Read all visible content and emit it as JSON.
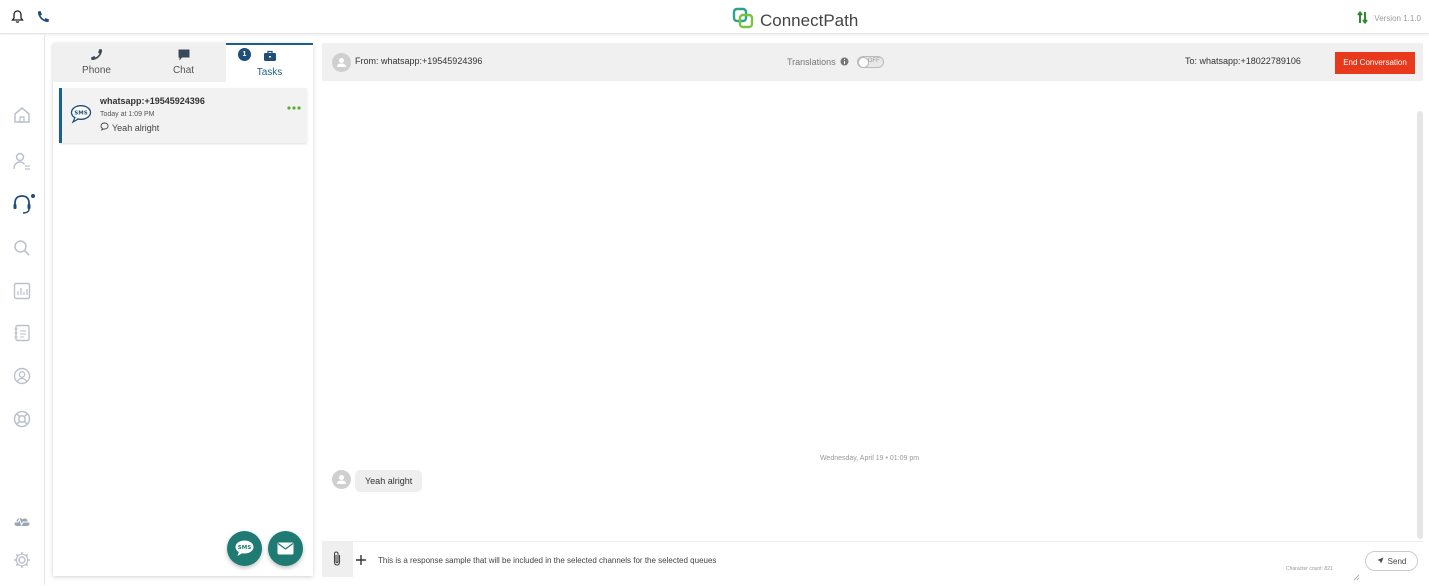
{
  "app": {
    "brand": "ConnectPath",
    "version": "Version 1.1.0"
  },
  "colors": {
    "accent": "#1f5f8b",
    "danger": "#e8391d",
    "fab": "#1e7a72",
    "sort": "#2e8b2e"
  },
  "topbar": {
    "icons": [
      "bell-icon",
      "phone-icon"
    ]
  },
  "sidebar": {
    "items": [
      "home-icon",
      "contacts-icon",
      "headset-icon",
      "search-icon",
      "reports-icon",
      "address-book-icon",
      "user-circle-icon",
      "support-icon",
      "cloud-status-icon",
      "settings-icon"
    ]
  },
  "tabs": [
    {
      "label": "Phone",
      "icon": "phone-icon"
    },
    {
      "label": "Chat",
      "icon": "chat-icon"
    },
    {
      "label": "Tasks",
      "icon": "briefcase-icon",
      "badge": "1",
      "active": true
    }
  ],
  "task": {
    "title": "whatsapp:+19545924396",
    "time": "Today at 1:09 PM",
    "message": "Yeah alright",
    "icon": "sms-bubble-icon"
  },
  "conversation": {
    "from": "From: whatsapp:+19545924396",
    "translations_label": "Translations",
    "translations_state": "OFF",
    "to": "To: whatsapp:+18022789106",
    "end_label": "End Conversation",
    "date_separator": "Wednesday, April 19 • 01:09 pm",
    "messages": [
      {
        "text": "Yeah alright"
      }
    ]
  },
  "composer": {
    "text": "This is a response sample that will be included in the selected channels for the selected queues",
    "char_count": "Character count: 821",
    "send_label": "Send"
  }
}
